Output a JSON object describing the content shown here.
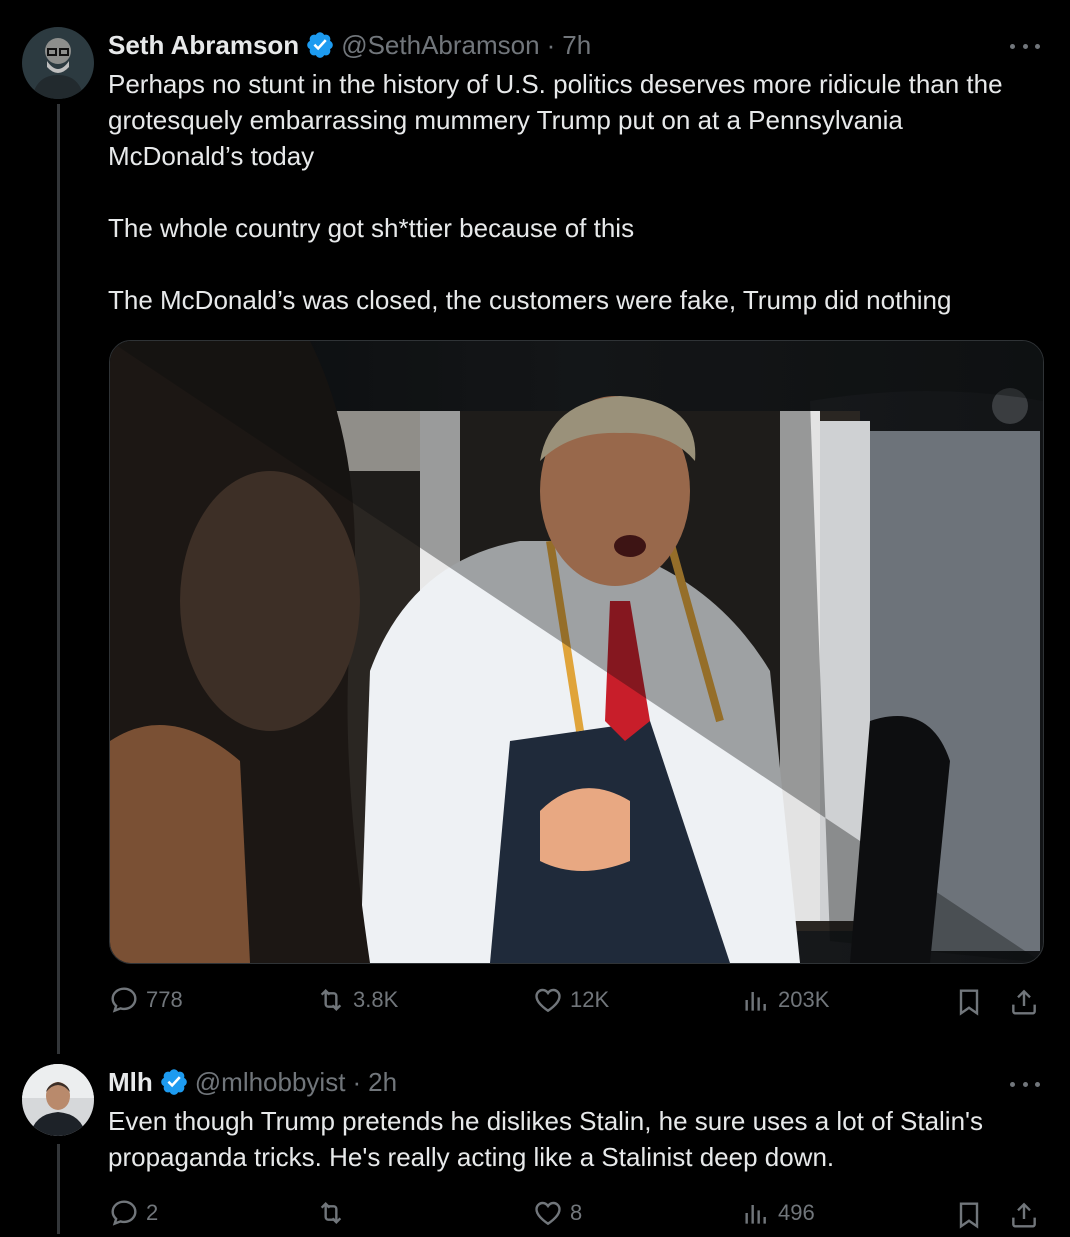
{
  "posts": [
    {
      "author_name": "Seth Abramson",
      "handle": "@SethAbramson",
      "separator": "·",
      "time": "7h",
      "paragraphs": [
        "Perhaps no stunt in the history of U.S. politics deserves more ridicule than the grotesquely embarrassing mummery Trump put on at a Pennsylvania McDonald’s today",
        "The whole country got sh*ttier because of this",
        "The McDonald’s was closed, the customers were fake, Trump did nothing"
      ],
      "stats": {
        "replies": "778",
        "reposts": "3.8K",
        "likes": "12K",
        "views": "203K"
      }
    },
    {
      "author_name": "Mlh",
      "handle": "@mlhobbyist",
      "separator": "·",
      "time": "2h",
      "paragraphs": [
        "Even though Trump pretends he dislikes Stalin, he sure uses a lot of Stalin's propaganda tricks. He's really acting like a Stalinist deep down."
      ],
      "stats": {
        "replies": "2",
        "reposts": "",
        "likes": "8",
        "views": "496"
      }
    }
  ],
  "colors": {
    "background": "#000000",
    "text": "#e7e9ea",
    "muted": "#71767b",
    "verified": "#1d9bf0",
    "divider": "#2f3336"
  }
}
